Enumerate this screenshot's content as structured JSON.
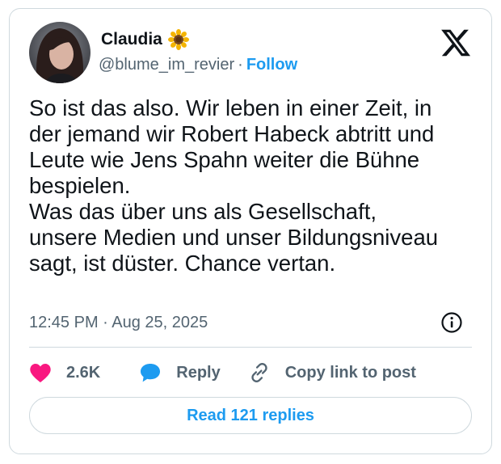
{
  "author": {
    "display_name": "Claudia",
    "emoji": "sunflower-emoji",
    "handle": "@blume_im_revier",
    "separator": "·",
    "follow_label": "Follow"
  },
  "platform_icon": "x-logo-icon",
  "tweet": {
    "lines": [
      "So ist das also. Wir leben in einer Zeit, in",
      "der jemand wir Robert Habeck abtritt und",
      "Leute wie Jens Spahn weiter die Bühne",
      "bespielen.",
      "Was das über uns als Gesellschaft,",
      "unsere Medien und unser Bildungsniveau",
      "sagt, ist düster. Chance vertan."
    ],
    "timestamp": "12:45 PM · Aug 25, 2025"
  },
  "actions": {
    "like_count": "2.6K",
    "reply_label": "Reply",
    "copy_label": "Copy link to post"
  },
  "read_replies_label": "Read 121 replies",
  "colors": {
    "accent": "#1d9bf0",
    "like": "#f91880",
    "muted": "#536471",
    "text": "#0f1419",
    "border": "#cfd9de"
  }
}
